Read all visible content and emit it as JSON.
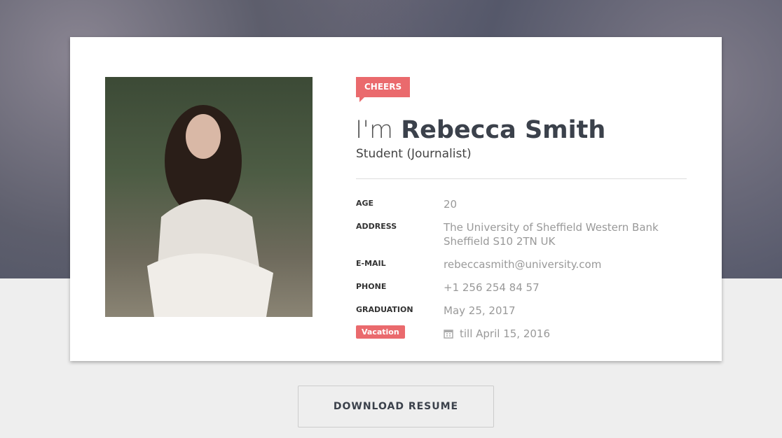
{
  "profile": {
    "tag": "CHEERS",
    "greeting": "I'm",
    "name": "Rebecca Smith",
    "role": "Student (Journalist)",
    "fields": [
      {
        "label": "AGE",
        "value": "20"
      },
      {
        "label": "ADDRESS",
        "value": "The University of Sheffield Western Bank",
        "value2": "Sheffield S10 2TN UK"
      },
      {
        "label": "E-MAIL",
        "value": "rebeccasmith@university.com"
      },
      {
        "label": "PHONE",
        "value": "+1 256 254 84 57"
      },
      {
        "label": "GRADUATION",
        "value": "May 25, 2017"
      }
    ],
    "vacation": {
      "badge": "Vacation",
      "icon": "calendar-icon",
      "value": "till April 15, 2016"
    }
  },
  "download_label": "DOWNLOAD RESUME",
  "colors": {
    "accent": "#ea6a6d",
    "text": "#3b414b"
  }
}
